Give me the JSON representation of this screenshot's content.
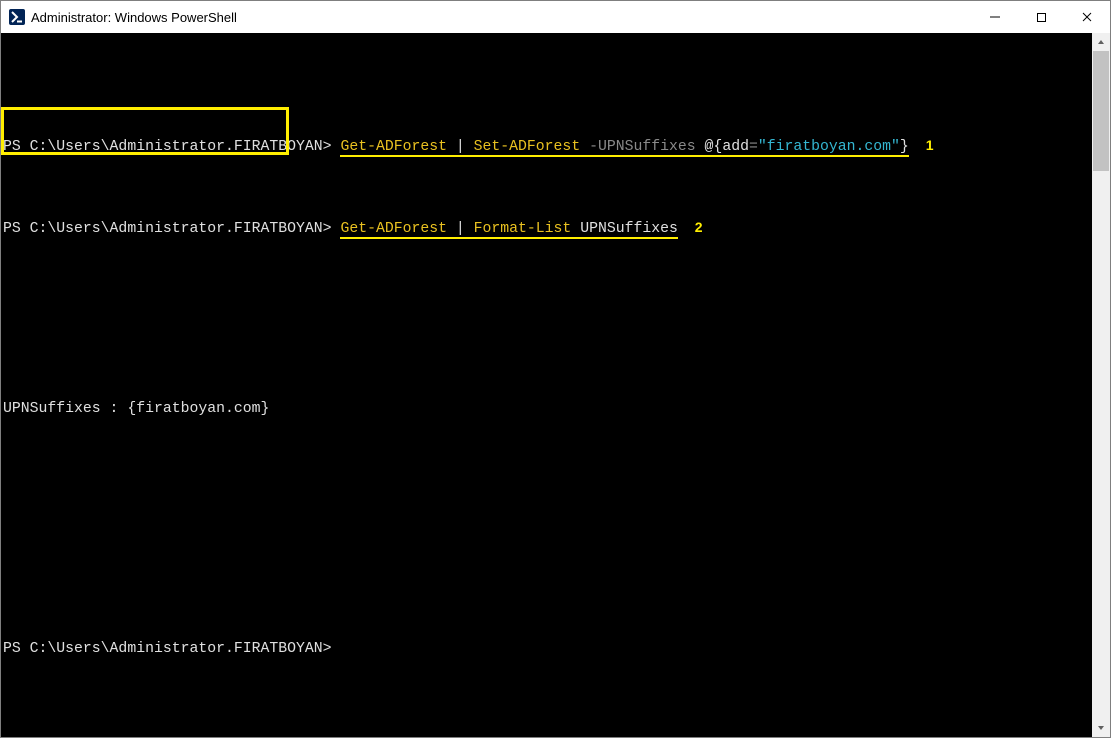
{
  "window": {
    "title": "Administrator: Windows PowerShell"
  },
  "icons": {
    "app": "powershell-icon"
  },
  "terminal": {
    "prompt": "PS C:\\Users\\Administrator.FIRATBOYAN>",
    "cmd1": {
      "c1": "Get-ADForest",
      "pipe": " | ",
      "c2": "Set-ADForest",
      "param": "-UPNSuffixes",
      "arg_open": "@{",
      "arg_key": "add",
      "arg_eq": "=",
      "arg_val": "\"firatboyan.com\"",
      "arg_close": "}",
      "anno": "1"
    },
    "cmd2": {
      "c1": "Get-ADForest",
      "pipe": " | ",
      "c2": "Format-List",
      "arg": " UPNSuffixes",
      "anno": "2"
    },
    "output": {
      "text": "UPNSuffixes : {firatboyan.com}"
    }
  }
}
